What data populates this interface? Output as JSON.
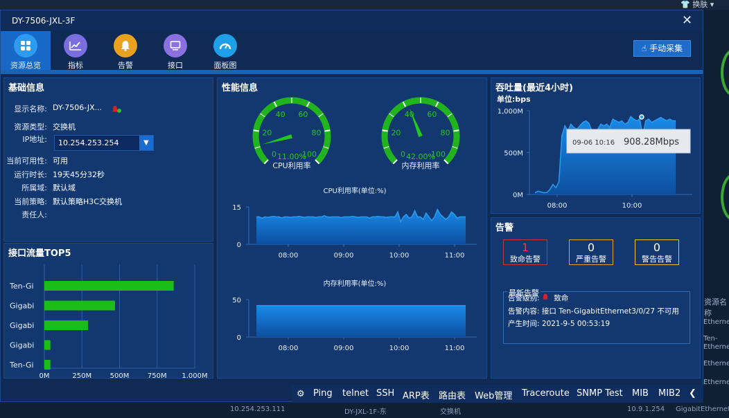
{
  "background": {
    "skin_label": "换肤",
    "resource_name_label": "资源名称",
    "rows": [
      "Ethernet",
      "Ten-",
      "Ethernet",
      "Ethernet",
      "Ethernet"
    ],
    "bottom_row": [
      "10.254.253.111",
      "DY-JXL-1F-东",
      "交换机",
      "10.9.1.254",
      "GigabitEthernet"
    ]
  },
  "window": {
    "title": "DY-7506-JXL-3F"
  },
  "nav": {
    "items": [
      {
        "label": "资源总览",
        "icon": "overview-grid-icon",
        "color": "#1868c8"
      },
      {
        "label": "指标",
        "icon": "trend-chart-icon",
        "color": "#7b6fe0"
      },
      {
        "label": "告警",
        "icon": "bell-icon",
        "color": "#e8a21e"
      },
      {
        "label": "接口",
        "icon": "monitor-icon",
        "color": "#8a70e0"
      },
      {
        "label": "面板图",
        "icon": "dashboard-icon",
        "color": "#1ea0e8"
      }
    ],
    "collect_label": "手动采集"
  },
  "basic": {
    "title": "基础信息",
    "rows": [
      {
        "k": "显示名称:",
        "v": "DY-7506-JX..."
      },
      {
        "k": "资源类型:",
        "v": "交换机"
      },
      {
        "k": "IP地址:",
        "v": "10.254.253.254"
      },
      {
        "k": "当前可用性:",
        "v": "可用"
      },
      {
        "k": "运行时长:",
        "v": "19天45分32秒"
      },
      {
        "k": "所属域:",
        "v": "默认域"
      },
      {
        "k": "当前策略:",
        "v": "默认策略H3C交换机"
      },
      {
        "k": "责任人:",
        "v": ""
      }
    ]
  },
  "top5": {
    "title": "接口流量TOP5",
    "chart_data": {
      "type": "bar",
      "categories": [
        "Ten-Gi",
        "Gigabi",
        "Gigabi",
        "Gigabi",
        "Ten-Gi"
      ],
      "values": [
        860,
        470,
        290,
        40,
        40
      ],
      "xlim": [
        0,
        1000
      ],
      "xticks": [
        "0M",
        "250M",
        "500M",
        "750M",
        "1,000M"
      ],
      "color": "#1cbd18"
    }
  },
  "perf": {
    "title": "性能信息",
    "cpu_gauge": {
      "value": 11.0,
      "text": "11.00%",
      "label": "CPU利用率",
      "ticks": [
        "0",
        "20",
        "40",
        "60",
        "80",
        "100"
      ]
    },
    "mem_gauge": {
      "value": 42.0,
      "text": "42.00%",
      "label": "内存利用率",
      "ticks": [
        "0",
        "20",
        "40",
        "60",
        "80",
        "100"
      ]
    },
    "cpu_chart": {
      "title": "CPU利用率(单位:%)",
      "chart_data": {
        "type": "area",
        "ylim": [
          0,
          15
        ],
        "yticks": [
          "15",
          "0"
        ],
        "xticks": [
          "08:00",
          "09:00",
          "10:00",
          "11:00"
        ],
        "values": [
          11,
          11,
          10.5,
          11,
          10.8,
          11,
          11.2,
          11,
          11,
          10.6,
          11,
          11,
          10.8,
          11,
          11,
          11.2,
          11,
          10.8,
          11,
          11,
          11,
          10.8,
          11,
          11,
          11.5,
          11,
          10.9,
          11,
          11,
          11,
          10.7,
          11,
          11,
          11,
          11.2,
          11,
          10.8,
          11,
          11,
          11,
          10.5,
          11,
          11,
          11.2,
          11,
          11,
          10.8,
          11,
          11,
          11,
          13,
          9,
          11,
          12,
          10.5,
          11,
          13.5,
          11,
          11,
          10,
          12.5,
          11,
          9.5,
          11,
          14,
          12,
          11,
          10,
          11,
          13,
          12,
          10.5,
          11,
          11,
          11
        ]
      }
    },
    "mem_chart": {
      "title": "内存利用率(单位:%)",
      "chart_data": {
        "type": "area",
        "ylim": [
          0,
          50
        ],
        "yticks": [
          "50",
          "0"
        ],
        "xticks": [
          "08:00",
          "09:00",
          "10:00",
          "11:00"
        ],
        "values": [
          42,
          42,
          42,
          42,
          42,
          42,
          42,
          42,
          42,
          42
        ]
      }
    }
  },
  "throughput": {
    "title": "吞吐量(最近4小时)",
    "unit": "单位:bps",
    "chart_data": {
      "type": "area",
      "ylim": [
        0,
        1000
      ],
      "yticks": [
        "1,000M",
        "500M",
        "0M"
      ],
      "xticks": [
        "08:00",
        "10:00"
      ],
      "values": [
        20,
        40,
        30,
        20,
        25,
        60,
        120,
        80,
        150,
        700,
        820,
        760,
        840,
        800,
        780,
        820,
        860,
        880,
        850,
        760,
        500,
        780,
        840,
        820,
        840,
        800,
        900,
        880,
        860,
        880,
        840,
        860,
        930,
        900,
        880,
        900,
        700,
        880,
        900,
        860,
        880,
        900,
        920,
        900,
        880,
        900,
        880,
        880
      ],
      "tooltip_time": "09-06 10:16",
      "tooltip_value": "908.28Mbps"
    }
  },
  "alarm": {
    "title": "告警",
    "boxes": [
      {
        "n": "1",
        "l": "致命告警",
        "color": "#d03030",
        "numColor": "#e04040"
      },
      {
        "n": "0",
        "l": "严重告警",
        "color": "#f0a030",
        "numColor": "#ffffff"
      },
      {
        "n": "0",
        "l": "警告告警",
        "color": "#f0c030",
        "numColor": "#ffffff"
      }
    ],
    "latest_title": "最新告警",
    "level_k": "告警级别:",
    "level_v": "致命",
    "content_k": "告警内容:",
    "content_v": "接口 Ten-GigabitEthernet3/0/27 不可用",
    "time_k": "产生时间:",
    "time_v": "2021-9-5 00:53:19"
  },
  "toolbar": {
    "items": [
      "Ping",
      "telnet",
      "SSH",
      "ARP表",
      "路由表",
      "Web管理",
      "Traceroute",
      "SNMP Test",
      "MIB",
      "MIB2"
    ]
  }
}
